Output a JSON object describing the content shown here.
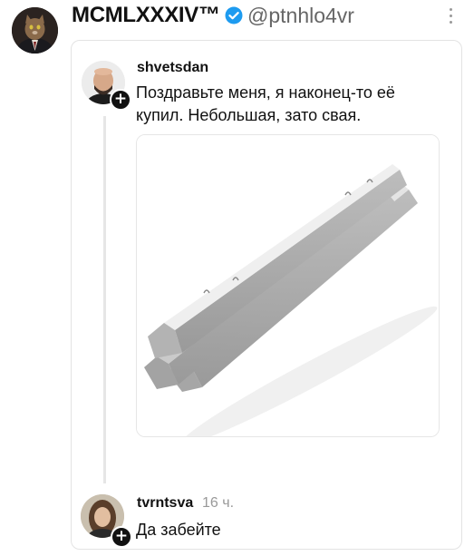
{
  "author": {
    "name": "MCMLXXXIV™",
    "handle": "@ptnhlo4vr",
    "avatar": "cat-in-suit-avatar",
    "verified_color": "#1d9bf0"
  },
  "post": {
    "username": "shvetsdan",
    "text": "Поздравьте меня, я наконец-то её купил. Небольшая, зато свая.",
    "image": "concrete-piles-photo"
  },
  "reply": {
    "username": "tvrntsva",
    "time": "16 ч.",
    "text": "Да забейте"
  },
  "icons": {
    "follow": "+",
    "more": "more-vertical-icon"
  }
}
